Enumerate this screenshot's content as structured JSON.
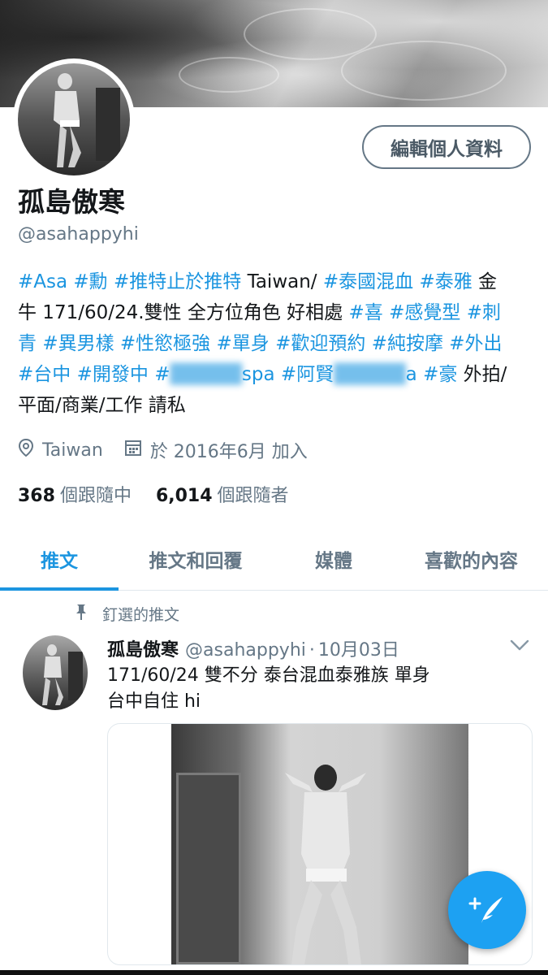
{
  "profile": {
    "edit_label": "編輯個人資料",
    "name": "孤島傲寒",
    "handle": "@asahappyhi",
    "bio_lines": [
      [
        {
          "t": "#Asa",
          "tag": true
        },
        {
          "t": " ",
          "tag": false
        },
        {
          "t": "#勳",
          "tag": true
        },
        {
          "t": " ",
          "tag": false
        },
        {
          "t": "#推特止於推特",
          "tag": true
        },
        {
          "t": " Taiwan/ ",
          "tag": false
        },
        {
          "t": "#泰國混血",
          "tag": true
        },
        {
          "t": " ",
          "tag": false
        },
        {
          "t": "#泰雅",
          "tag": true
        },
        {
          "t": " 金",
          "tag": false
        }
      ],
      [
        {
          "t": "牛 171/60/24.雙性 全方位角色 好相處 ",
          "tag": false
        },
        {
          "t": "#喜",
          "tag": true
        },
        {
          "t": " ",
          "tag": false
        },
        {
          "t": "#感覺型",
          "tag": true
        },
        {
          "t": " ",
          "tag": false
        },
        {
          "t": "#刺",
          "tag": true
        }
      ],
      [
        {
          "t": "青",
          "tag": true
        },
        {
          "t": " ",
          "tag": false
        },
        {
          "t": "#異男樣",
          "tag": true
        },
        {
          "t": " ",
          "tag": false
        },
        {
          "t": "#性慾極強",
          "tag": true
        },
        {
          "t": " ",
          "tag": false
        },
        {
          "t": "#單身",
          "tag": true
        },
        {
          "t": "  ",
          "tag": false
        },
        {
          "t": "#歡迎預約",
          "tag": true
        },
        {
          "t": " ",
          "tag": false
        },
        {
          "t": "#純按摩",
          "tag": true
        },
        {
          "t": " ",
          "tag": false
        },
        {
          "t": "#外出",
          "tag": true
        }
      ],
      [
        {
          "t": "#台中",
          "tag": true
        },
        {
          "t": " ",
          "tag": false
        },
        {
          "t": "#開發中",
          "tag": true
        },
        {
          "t": " ",
          "tag": false
        },
        {
          "t": "#",
          "tag": true
        },
        {
          "t": "█████",
          "blur": true
        },
        {
          "t": "spa",
          "tag": true
        },
        {
          "t": " ",
          "tag": false
        },
        {
          "t": "#阿賢",
          "tag": true
        },
        {
          "t": "█████",
          "blur": true
        },
        {
          "t": "a",
          "tag": true
        },
        {
          "t": " ",
          "tag": false
        },
        {
          "t": "#豪",
          "tag": true
        },
        {
          "t": " 外拍/",
          "tag": false
        }
      ],
      [
        {
          "t": "平面/商業/工作  請私",
          "tag": false
        }
      ]
    ],
    "location": "Taiwan",
    "joined": "於 2016年6月 加入",
    "following_count": "368",
    "following_label": "個跟隨中",
    "followers_count": "6,014",
    "followers_label": "個跟隨者"
  },
  "tabs": [
    {
      "label": "推文",
      "active": true
    },
    {
      "label": "推文和回覆",
      "active": false
    },
    {
      "label": "媒體",
      "active": false
    },
    {
      "label": "喜歡的內容",
      "active": false
    }
  ],
  "tweet": {
    "pinned_label": "釘選的推文",
    "name": "孤島傲寒",
    "handle": "@asahappyhi",
    "dot": "·",
    "date": "10月03日",
    "line1": "171/60/24 雙不分 泰台混血泰雅族 單身",
    "line2": "台中自住 hi"
  },
  "colors": {
    "accent": "#1b95e0",
    "secondary": "#657786",
    "fab": "#1da1f2"
  },
  "icons": {
    "location": "location-pin-icon",
    "calendar": "calendar-icon",
    "pin": "pin-icon",
    "chevron": "chevron-down-icon",
    "compose": "compose-tweet-icon"
  }
}
